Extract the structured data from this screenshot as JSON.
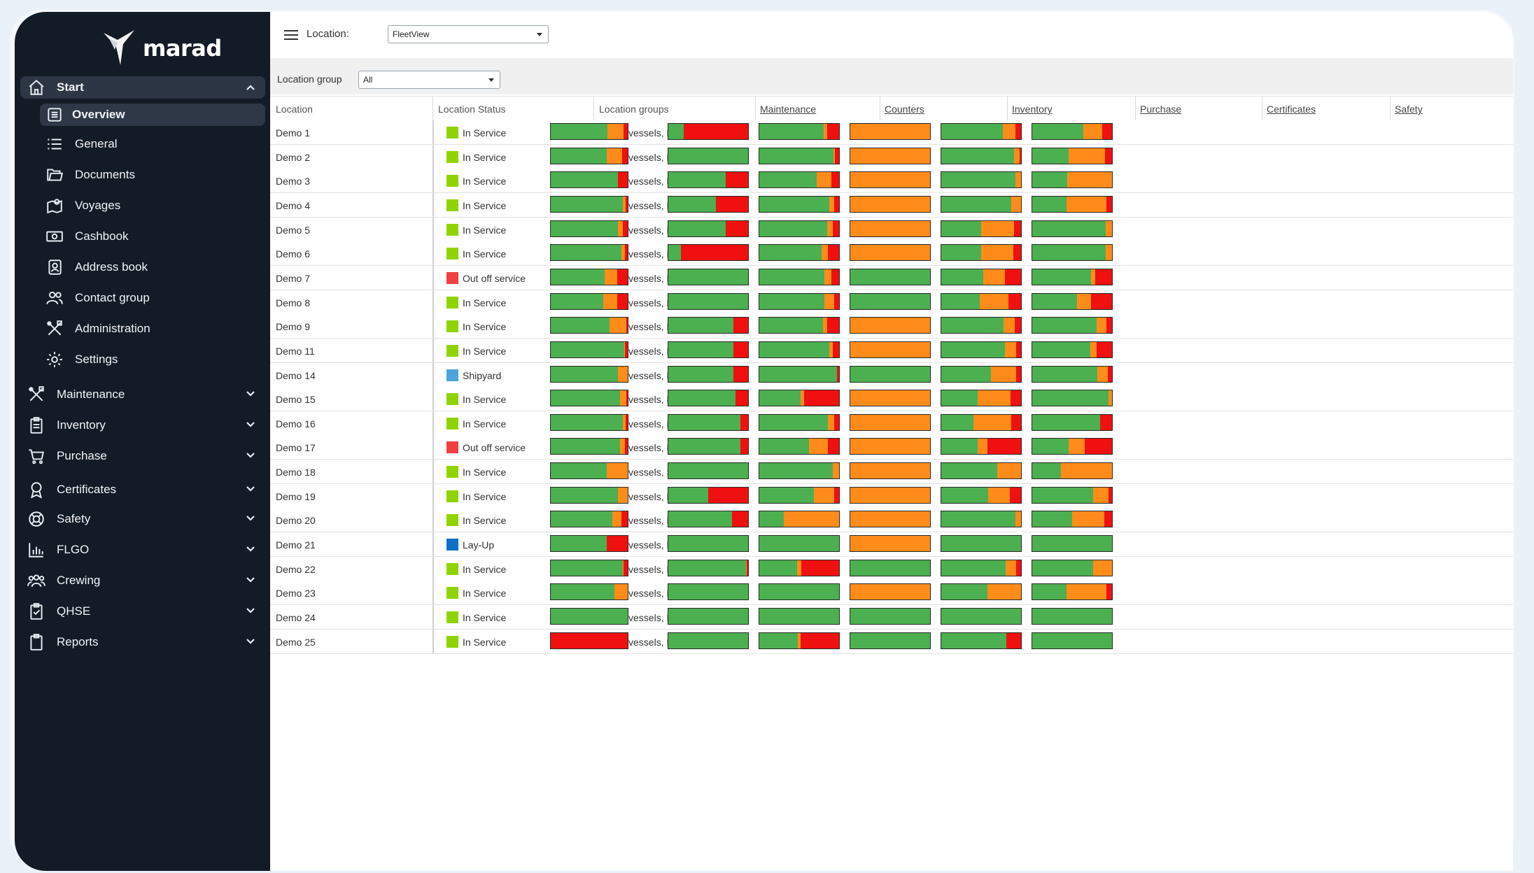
{
  "app": {
    "logo_text": "marad"
  },
  "colors": {
    "green": "#4caf50",
    "orange": "#ff8c1a",
    "red": "#f01010",
    "in_service": "#8fd400",
    "out_of_service": "#f04040",
    "shipyard": "#4da3dc",
    "lay_up": "#0e6fc9",
    "sidebar_bg": "#131b26"
  },
  "sidebar": {
    "start": {
      "label": "Start",
      "icon": "home-icon"
    },
    "sub_items": [
      {
        "label": "Overview",
        "icon": "list-icon",
        "active": true
      },
      {
        "label": "General",
        "icon": "list-lines-icon"
      },
      {
        "label": "Documents",
        "icon": "folder-icon"
      },
      {
        "label": "Voyages",
        "icon": "map-icon"
      },
      {
        "label": "Cashbook",
        "icon": "cash-icon"
      },
      {
        "label": "Address book",
        "icon": "contact-card-icon"
      },
      {
        "label": "Contact group",
        "icon": "users-icon"
      },
      {
        "label": "Administration",
        "icon": "tools-icon"
      },
      {
        "label": "Settings",
        "icon": "gear-icon"
      }
    ],
    "modules": [
      {
        "label": "Maintenance",
        "icon": "tools-icon"
      },
      {
        "label": "Inventory",
        "icon": "clipboard-icon"
      },
      {
        "label": "Purchase",
        "icon": "cart-icon"
      },
      {
        "label": "Certificates",
        "icon": "award-icon"
      },
      {
        "label": "Safety",
        "icon": "lifebuoy-icon"
      },
      {
        "label": "FLGO",
        "icon": "bar-chart-icon"
      },
      {
        "label": "Crewing",
        "icon": "crew-icon"
      },
      {
        "label": "QHSE",
        "icon": "check-clipboard-icon"
      },
      {
        "label": "Reports",
        "icon": "report-icon"
      }
    ]
  },
  "toolbar": {
    "location_label": "Location:",
    "location_value": "FleetView",
    "location_group_label": "Location group",
    "location_group_value": "All"
  },
  "table": {
    "headers": {
      "location": "Location",
      "status": "Location Status",
      "groups": "Location groups",
      "maintenance": "Maintenance",
      "counters": "Counters",
      "inventory": "Inventory",
      "purchase": "Purchase",
      "certificates": "Certificates",
      "safety": "Safety"
    },
    "rows": [
      {
        "location": "Demo 1",
        "status": "In Service",
        "status_key": "in_service",
        "groups": "Active vessels, Europe",
        "bars": {
          "maintenance": [
            0.74,
            0.21,
            0.05
          ],
          "counters": [
            0.19,
            0.0,
            0.81
          ],
          "inventory": [
            0.81,
            0.04,
            0.15
          ],
          "purchase": [
            0,
            1,
            0
          ],
          "certificates": [
            0.77,
            0.16,
            0.07
          ],
          "safety": [
            0.64,
            0.24,
            0.12
          ]
        }
      },
      {
        "location": "Demo 2",
        "status": "In Service",
        "status_key": "in_service",
        "groups": "Active vessels, Europe",
        "bars": {
          "maintenance": [
            0.73,
            0.2,
            0.07
          ],
          "counters": [
            1,
            0,
            0
          ],
          "inventory": [
            0.93,
            0.02,
            0.05
          ],
          "purchase": [
            0,
            1,
            0
          ],
          "certificates": [
            0.91,
            0.07,
            0.02
          ],
          "safety": [
            0.46,
            0.45,
            0.09
          ]
        }
      },
      {
        "location": "Demo 3",
        "status": "In Service",
        "status_key": "in_service",
        "groups": "Active vessels, Europe",
        "bars": {
          "maintenance": [
            0.87,
            0,
            0.13
          ],
          "counters": [
            0.72,
            0,
            0.28
          ],
          "inventory": [
            0.72,
            0.18,
            0.1
          ],
          "purchase": [
            0,
            1,
            0
          ],
          "certificates": [
            0.93,
            0.07,
            0
          ],
          "safety": [
            0.44,
            0.56,
            0
          ]
        }
      },
      {
        "location": "Demo 4",
        "status": "In Service",
        "status_key": "in_service",
        "groups": "Active vessels, Europe",
        "bars": {
          "maintenance": [
            0.94,
            0.03,
            0.03
          ],
          "counters": [
            0.6,
            0,
            0.4
          ],
          "inventory": [
            0.88,
            0.06,
            0.06
          ],
          "purchase": [
            0,
            1,
            0
          ],
          "certificates": [
            0.88,
            0.12,
            0
          ],
          "safety": [
            0.43,
            0.5,
            0.07
          ]
        }
      },
      {
        "location": "Demo 5",
        "status": "In Service",
        "status_key": "in_service",
        "groups": "Active vessels, Europe",
        "bars": {
          "maintenance": [
            0.87,
            0.07,
            0.06
          ],
          "counters": [
            0.72,
            0,
            0.28
          ],
          "inventory": [
            0.85,
            0.07,
            0.08
          ],
          "purchase": [
            0,
            1,
            0
          ],
          "certificates": [
            0.5,
            0.41,
            0.09
          ],
          "safety": [
            0.92,
            0.08,
            0
          ]
        }
      },
      {
        "location": "Demo 6",
        "status": "In Service",
        "status_key": "in_service",
        "groups": "Active vessels, Belgium",
        "bars": {
          "maintenance": [
            0.92,
            0.04,
            0.04
          ],
          "counters": [
            0.16,
            0,
            0.84
          ],
          "inventory": [
            0.78,
            0.08,
            0.14
          ],
          "purchase": [
            0,
            1,
            0
          ],
          "certificates": [
            0.5,
            0.4,
            0.1
          ],
          "safety": [
            0.92,
            0.08,
            0
          ]
        }
      },
      {
        "location": "Demo 7",
        "status": "Out off service",
        "status_key": "out_of_service",
        "groups": "Active vessels, Europe",
        "bars": {
          "maintenance": [
            0.7,
            0.16,
            0.14
          ],
          "counters": [
            1,
            0,
            0
          ],
          "inventory": [
            0.82,
            0.08,
            0.1
          ],
          "purchase": [
            1,
            0,
            0
          ],
          "certificates": [
            0.53,
            0.27,
            0.2
          ],
          "safety": [
            0.74,
            0.05,
            0.21
          ]
        }
      },
      {
        "location": "Demo 8",
        "status": "In Service",
        "status_key": "in_service",
        "groups": "Active vessels, Europe",
        "bars": {
          "maintenance": [
            0.68,
            0.18,
            0.14
          ],
          "counters": [
            1,
            0,
            0
          ],
          "inventory": [
            0.82,
            0.12,
            0.06
          ],
          "purchase": [
            1,
            0,
            0
          ],
          "certificates": [
            0.48,
            0.36,
            0.16
          ],
          "safety": [
            0.56,
            0.18,
            0.26
          ]
        }
      },
      {
        "location": "Demo 9",
        "status": "In Service",
        "status_key": "in_service",
        "groups": "Active vessels, Europe",
        "bars": {
          "maintenance": [
            0.76,
            0.22,
            0.02
          ],
          "counters": [
            0.82,
            0,
            0.18
          ],
          "inventory": [
            0.8,
            0.05,
            0.15
          ],
          "purchase": [
            0,
            1,
            0
          ],
          "certificates": [
            0.78,
            0.14,
            0.08
          ],
          "safety": [
            0.81,
            0.12,
            0.07
          ]
        }
      },
      {
        "location": "Demo 11",
        "status": "In Service",
        "status_key": "in_service",
        "groups": "Active vessels, Europe",
        "bars": {
          "maintenance": [
            0.95,
            0.01,
            0.04
          ],
          "counters": [
            0.82,
            0,
            0.18
          ],
          "inventory": [
            0.88,
            0.04,
            0.08
          ],
          "purchase": [
            0,
            1,
            0
          ],
          "certificates": [
            0.8,
            0.14,
            0.06
          ],
          "safety": [
            0.73,
            0.08,
            0.19
          ]
        }
      },
      {
        "location": "Demo 14",
        "status": "Shipyard",
        "status_key": "shipyard",
        "groups": "Active vessels, Europe",
        "bars": {
          "maintenance": [
            0.87,
            0.13,
            0
          ],
          "counters": [
            0.82,
            0,
            0.18
          ],
          "inventory": [
            0.97,
            0,
            0.03
          ],
          "purchase": [
            1,
            0,
            0
          ],
          "certificates": [
            0.62,
            0.32,
            0.06
          ],
          "safety": [
            0.82,
            0.13,
            0.05
          ]
        }
      },
      {
        "location": "Demo 15",
        "status": "In Service",
        "status_key": "in_service",
        "groups": "Active vessels, Europe",
        "bars": {
          "maintenance": [
            0.9,
            0.08,
            0.02
          ],
          "counters": [
            0.84,
            0,
            0.16
          ],
          "inventory": [
            0.52,
            0.04,
            0.44
          ],
          "purchase": [
            0,
            1,
            0
          ],
          "certificates": [
            0.46,
            0.41,
            0.13
          ],
          "safety": [
            0.96,
            0.04,
            0
          ]
        }
      },
      {
        "location": "Demo 16",
        "status": "In Service",
        "status_key": "in_service",
        "groups": "Active vessels, Belgium",
        "bars": {
          "maintenance": [
            0.94,
            0.03,
            0.03
          ],
          "counters": [
            0.9,
            0,
            0.1
          ],
          "inventory": [
            0.86,
            0.08,
            0.06
          ],
          "purchase": [
            0,
            1,
            0
          ],
          "certificates": [
            0.4,
            0.48,
            0.12
          ],
          "safety": [
            0.85,
            0,
            0.15
          ]
        }
      },
      {
        "location": "Demo 17",
        "status": "Out off service",
        "status_key": "out_of_service",
        "groups": "Active vessels, Europe",
        "bars": {
          "maintenance": [
            0.9,
            0.06,
            0.04
          ],
          "counters": [
            0.9,
            0,
            0.1
          ],
          "inventory": [
            0.62,
            0.24,
            0.14
          ],
          "purchase": [
            0,
            1,
            0
          ],
          "certificates": [
            0.46,
            0.12,
            0.42
          ],
          "safety": [
            0.46,
            0.2,
            0.34
          ]
        }
      },
      {
        "location": "Demo 18",
        "status": "In Service",
        "status_key": "in_service",
        "groups": "Active vessels, Spain",
        "bars": {
          "maintenance": [
            0.73,
            0.27,
            0
          ],
          "counters": [
            1,
            0,
            0
          ],
          "inventory": [
            0.92,
            0.08,
            0
          ],
          "purchase": [
            0,
            1,
            0
          ],
          "certificates": [
            0.7,
            0.3,
            0
          ],
          "safety": [
            0.36,
            0.64,
            0
          ]
        }
      },
      {
        "location": "Demo 19",
        "status": "In Service",
        "status_key": "in_service",
        "groups": "Active vessels, Europe",
        "bars": {
          "maintenance": [
            0.87,
            0.13,
            0
          ],
          "counters": [
            0.5,
            0,
            0.5
          ],
          "inventory": [
            0.68,
            0.26,
            0.06
          ],
          "purchase": [
            0,
            1,
            0
          ],
          "certificates": [
            0.59,
            0.27,
            0.14
          ],
          "safety": [
            0.76,
            0.2,
            0.04
          ]
        }
      },
      {
        "location": "Demo 20",
        "status": "In Service",
        "status_key": "in_service",
        "groups": "Active vessels, Europe",
        "bars": {
          "maintenance": [
            0.8,
            0.12,
            0.08
          ],
          "counters": [
            0.8,
            0,
            0.2
          ],
          "inventory": [
            0.31,
            0.69,
            0
          ],
          "purchase": [
            0,
            1,
            0
          ],
          "certificates": [
            0.93,
            0.07,
            0
          ],
          "safety": [
            0.5,
            0.4,
            0.1
          ]
        }
      },
      {
        "location": "Demo 21",
        "status": "Lay-Up",
        "status_key": "lay_up",
        "groups": "Active vessels, Europe",
        "bars": {
          "maintenance": [
            0.73,
            0,
            0.27
          ],
          "counters": [
            1,
            0,
            0
          ],
          "inventory": [
            1,
            0,
            0
          ],
          "purchase": [
            0,
            1,
            0
          ],
          "certificates": [
            1,
            0,
            0
          ],
          "safety": [
            1,
            0,
            0
          ]
        }
      },
      {
        "location": "Demo 22",
        "status": "In Service",
        "status_key": "in_service",
        "groups": "Active vessels, Belgium",
        "bars": {
          "maintenance": [
            0.94,
            0.01,
            0.05
          ],
          "counters": [
            0.97,
            0.01,
            0.02
          ],
          "inventory": [
            0.47,
            0.06,
            0.47
          ],
          "purchase": [
            1,
            0,
            0
          ],
          "certificates": [
            0.81,
            0.13,
            0.06
          ],
          "safety": [
            0.76,
            0.24,
            0
          ]
        }
      },
      {
        "location": "Demo 23",
        "status": "In Service",
        "status_key": "in_service",
        "groups": "Active vessels, Europe",
        "bars": {
          "maintenance": [
            0.83,
            0.17,
            0
          ],
          "counters": [
            1,
            0,
            0
          ],
          "inventory": [
            1,
            0,
            0
          ],
          "purchase": [
            0,
            1,
            0
          ],
          "certificates": [
            0.58,
            0.42,
            0
          ],
          "safety": [
            0.43,
            0.5,
            0.07
          ]
        }
      },
      {
        "location": "Demo 24",
        "status": "In Service",
        "status_key": "in_service",
        "groups": "Active vessels, Europe",
        "bars": {
          "maintenance": [
            1,
            0,
            0
          ],
          "counters": [
            1,
            0,
            0
          ],
          "inventory": [
            1,
            0,
            0
          ],
          "purchase": [
            1,
            0,
            0
          ],
          "certificates": [
            1,
            0,
            0
          ],
          "safety": [
            1,
            0,
            0
          ]
        }
      },
      {
        "location": "Demo 25",
        "status": "In Service",
        "status_key": "in_service",
        "groups": "Active vessels, Belgium",
        "bars": {
          "maintenance": [
            0,
            0,
            1
          ],
          "counters": [
            1,
            0,
            0
          ],
          "inventory": [
            0.48,
            0.04,
            0.48
          ],
          "purchase": [
            1,
            0,
            0
          ],
          "certificates": [
            0.82,
            0,
            0.18
          ],
          "safety": [
            1,
            0,
            0
          ]
        }
      }
    ]
  }
}
